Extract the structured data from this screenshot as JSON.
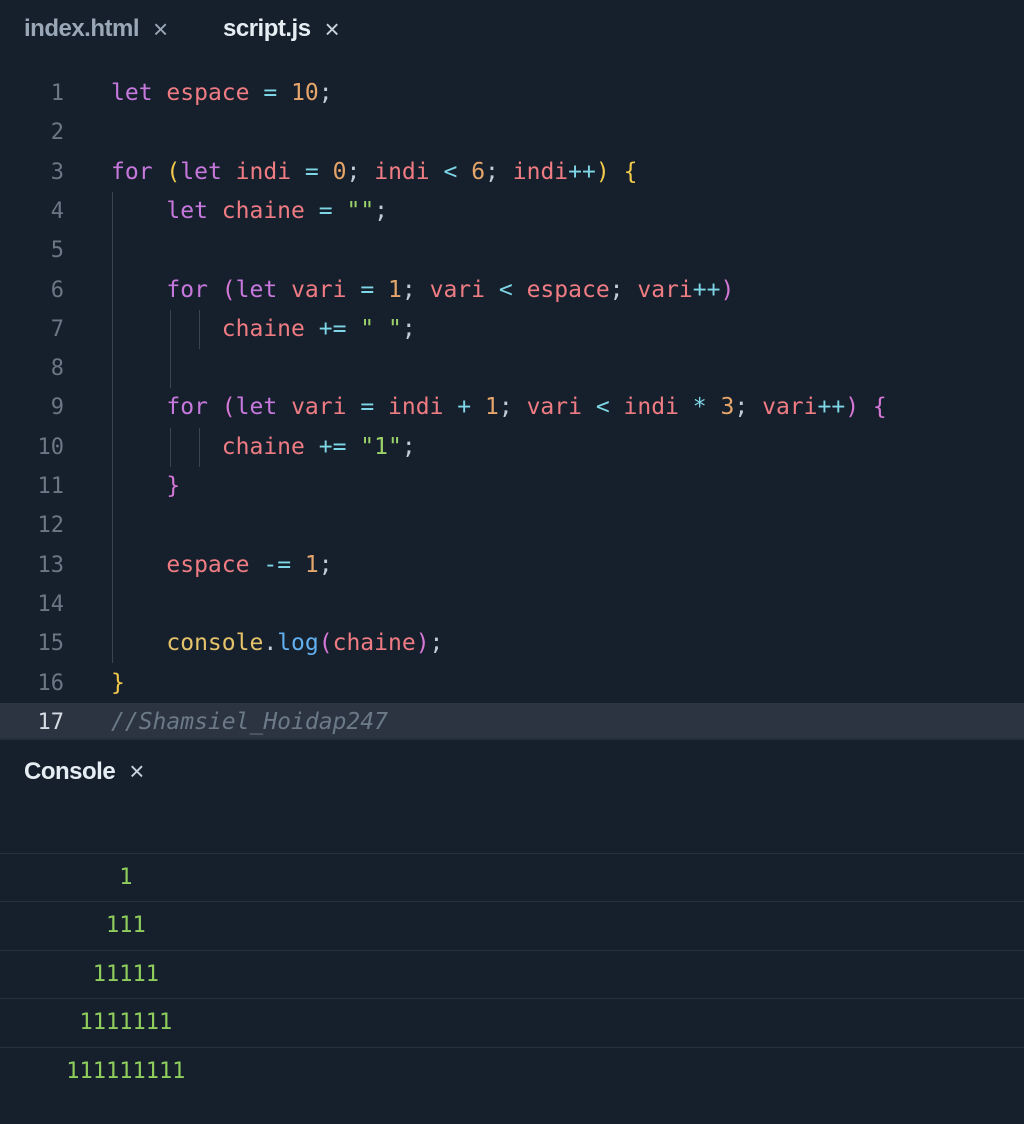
{
  "tabs": [
    {
      "label": "index.html",
      "active": false
    },
    {
      "label": "script.js",
      "active": true
    }
  ],
  "close_glyph": "×",
  "editor": {
    "current_line": 17,
    "lines": [
      {
        "n": "1",
        "tokens": [
          [
            "kw",
            "let"
          ],
          [
            "plain",
            " "
          ],
          [
            "var",
            "espace"
          ],
          [
            "plain",
            " "
          ],
          [
            "op",
            "="
          ],
          [
            "plain",
            " "
          ],
          [
            "num",
            "10"
          ],
          [
            "punct",
            ";"
          ]
        ]
      },
      {
        "n": "2",
        "tokens": []
      },
      {
        "n": "3",
        "tokens": [
          [
            "kw",
            "for"
          ],
          [
            "plain",
            " "
          ],
          [
            "paren1",
            "("
          ],
          [
            "kw",
            "let"
          ],
          [
            "plain",
            " "
          ],
          [
            "var",
            "indi"
          ],
          [
            "plain",
            " "
          ],
          [
            "op",
            "="
          ],
          [
            "plain",
            " "
          ],
          [
            "num",
            "0"
          ],
          [
            "punct",
            ";"
          ],
          [
            "plain",
            " "
          ],
          [
            "var",
            "indi"
          ],
          [
            "plain",
            " "
          ],
          [
            "op",
            "<"
          ],
          [
            "plain",
            " "
          ],
          [
            "num",
            "6"
          ],
          [
            "punct",
            ";"
          ],
          [
            "plain",
            " "
          ],
          [
            "var",
            "indi"
          ],
          [
            "op",
            "++"
          ],
          [
            "paren1",
            ")"
          ],
          [
            "plain",
            " "
          ],
          [
            "paren1",
            "{"
          ]
        ]
      },
      {
        "n": "4",
        "tokens": [
          [
            "plain",
            "    "
          ],
          [
            "kw",
            "let"
          ],
          [
            "plain",
            " "
          ],
          [
            "var",
            "chaine"
          ],
          [
            "plain",
            " "
          ],
          [
            "op",
            "="
          ],
          [
            "plain",
            " "
          ],
          [
            "str",
            "\"\""
          ],
          [
            "punct",
            ";"
          ]
        ]
      },
      {
        "n": "5",
        "tokens": []
      },
      {
        "n": "6",
        "tokens": [
          [
            "plain",
            "    "
          ],
          [
            "kw",
            "for"
          ],
          [
            "plain",
            " "
          ],
          [
            "paren2",
            "("
          ],
          [
            "kw",
            "let"
          ],
          [
            "plain",
            " "
          ],
          [
            "var",
            "vari"
          ],
          [
            "plain",
            " "
          ],
          [
            "op",
            "="
          ],
          [
            "plain",
            " "
          ],
          [
            "num",
            "1"
          ],
          [
            "punct",
            ";"
          ],
          [
            "plain",
            " "
          ],
          [
            "var",
            "vari"
          ],
          [
            "plain",
            " "
          ],
          [
            "op",
            "<"
          ],
          [
            "plain",
            " "
          ],
          [
            "var",
            "espace"
          ],
          [
            "punct",
            ";"
          ],
          [
            "plain",
            " "
          ],
          [
            "var",
            "vari"
          ],
          [
            "op",
            "++"
          ],
          [
            "paren2",
            ")"
          ]
        ]
      },
      {
        "n": "7",
        "tokens": [
          [
            "plain",
            "        "
          ],
          [
            "var",
            "chaine"
          ],
          [
            "plain",
            " "
          ],
          [
            "op",
            "+="
          ],
          [
            "plain",
            " "
          ],
          [
            "str",
            "\" \""
          ],
          [
            "punct",
            ";"
          ]
        ]
      },
      {
        "n": "8",
        "tokens": []
      },
      {
        "n": "9",
        "tokens": [
          [
            "plain",
            "    "
          ],
          [
            "kw",
            "for"
          ],
          [
            "plain",
            " "
          ],
          [
            "paren2",
            "("
          ],
          [
            "kw",
            "let"
          ],
          [
            "plain",
            " "
          ],
          [
            "var",
            "vari"
          ],
          [
            "plain",
            " "
          ],
          [
            "op",
            "="
          ],
          [
            "plain",
            " "
          ],
          [
            "var",
            "indi"
          ],
          [
            "plain",
            " "
          ],
          [
            "op",
            "+"
          ],
          [
            "plain",
            " "
          ],
          [
            "num",
            "1"
          ],
          [
            "punct",
            ";"
          ],
          [
            "plain",
            " "
          ],
          [
            "var",
            "vari"
          ],
          [
            "plain",
            " "
          ],
          [
            "op",
            "<"
          ],
          [
            "plain",
            " "
          ],
          [
            "var",
            "indi"
          ],
          [
            "plain",
            " "
          ],
          [
            "op",
            "*"
          ],
          [
            "plain",
            " "
          ],
          [
            "num",
            "3"
          ],
          [
            "punct",
            ";"
          ],
          [
            "plain",
            " "
          ],
          [
            "var",
            "vari"
          ],
          [
            "op",
            "++"
          ],
          [
            "paren2",
            ")"
          ],
          [
            "plain",
            " "
          ],
          [
            "paren2",
            "{"
          ]
        ]
      },
      {
        "n": "10",
        "tokens": [
          [
            "plain",
            "        "
          ],
          [
            "var",
            "chaine"
          ],
          [
            "plain",
            " "
          ],
          [
            "op",
            "+="
          ],
          [
            "plain",
            " "
          ],
          [
            "str",
            "\"1\""
          ],
          [
            "punct",
            ";"
          ]
        ]
      },
      {
        "n": "11",
        "tokens": [
          [
            "plain",
            "    "
          ],
          [
            "paren2",
            "}"
          ]
        ]
      },
      {
        "n": "12",
        "tokens": []
      },
      {
        "n": "13",
        "tokens": [
          [
            "plain",
            "    "
          ],
          [
            "var",
            "espace"
          ],
          [
            "plain",
            " "
          ],
          [
            "op",
            "-="
          ],
          [
            "plain",
            " "
          ],
          [
            "num",
            "1"
          ],
          [
            "punct",
            ";"
          ]
        ]
      },
      {
        "n": "14",
        "tokens": []
      },
      {
        "n": "15",
        "tokens": [
          [
            "plain",
            "    "
          ],
          [
            "obj",
            "console"
          ],
          [
            "punct",
            "."
          ],
          [
            "fn",
            "log"
          ],
          [
            "paren2",
            "("
          ],
          [
            "var",
            "chaine"
          ],
          [
            "paren2",
            ")"
          ],
          [
            "punct",
            ";"
          ]
        ]
      },
      {
        "n": "16",
        "tokens": [
          [
            "paren1",
            "}"
          ]
        ]
      },
      {
        "n": "17",
        "tokens": [
          [
            "com",
            "//Shamsiel_Hoidap247"
          ]
        ]
      }
    ]
  },
  "console": {
    "title": "Console",
    "output": [
      "         1",
      "        111",
      "       11111",
      "      1111111",
      "     111111111"
    ]
  },
  "colors": {
    "background": "#16202c",
    "keyword": "#c678dd",
    "variable": "#ef7b83",
    "number": "#e5a56b",
    "string": "#9bd26a",
    "output": "#8fce5c"
  }
}
